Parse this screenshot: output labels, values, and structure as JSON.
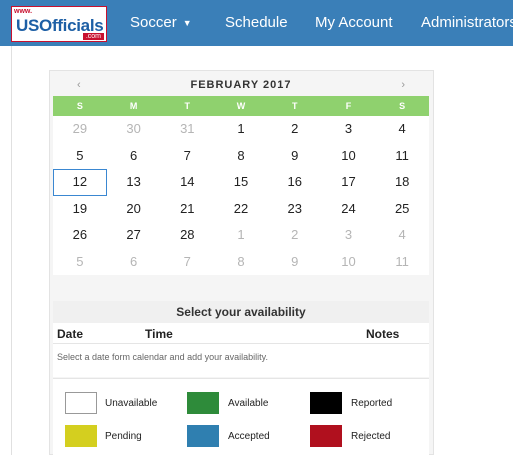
{
  "header": {
    "logo": {
      "www": "www.",
      "name": "USOfficials",
      "tld": ".com"
    },
    "nav": [
      {
        "label": "Soccer",
        "has_caret": true
      },
      {
        "label": "Schedule"
      },
      {
        "label": "My Account"
      },
      {
        "label": "Administrators"
      }
    ]
  },
  "calendar": {
    "prev": "‹",
    "next": "›",
    "month_title": "FEBRUARY 2017",
    "weekdays": [
      "S",
      "M",
      "T",
      "W",
      "T",
      "F",
      "S"
    ],
    "weeks": [
      [
        "29",
        "30",
        "31",
        "1",
        "2",
        "3",
        "4"
      ],
      [
        "5",
        "6",
        "7",
        "8",
        "9",
        "10",
        "11"
      ],
      [
        "12",
        "13",
        "14",
        "15",
        "16",
        "17",
        "18"
      ],
      [
        "19",
        "20",
        "21",
        "22",
        "23",
        "24",
        "25"
      ],
      [
        "26",
        "27",
        "28",
        "1",
        "2",
        "3",
        "4"
      ],
      [
        "5",
        "6",
        "7",
        "8",
        "9",
        "10",
        "11"
      ]
    ],
    "selected_date": "12"
  },
  "availability": {
    "heading": "Select your availability",
    "columns": {
      "date": "Date",
      "time": "Time",
      "notes": "Notes"
    },
    "hint": "Select a date form calendar and add your availability."
  },
  "legend": [
    {
      "label": "Unavailable",
      "color": "#ffffff"
    },
    {
      "label": "Available",
      "color": "#2e8b3a"
    },
    {
      "label": "Reported",
      "color": "#000000"
    },
    {
      "label": "Pending",
      "color": "#d4cf1f"
    },
    {
      "label": "Accepted",
      "color": "#2f7fb0"
    },
    {
      "label": "Rejected",
      "color": "#b0101e"
    }
  ]
}
